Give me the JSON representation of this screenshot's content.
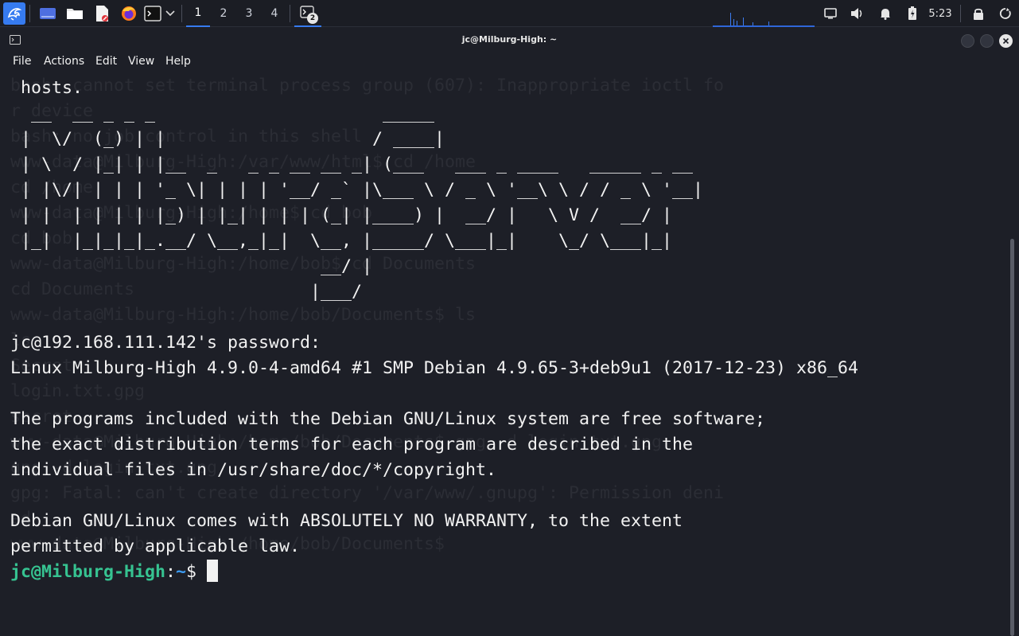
{
  "panel": {
    "workspaces": [
      "1",
      "2",
      "3",
      "4"
    ],
    "active_workspace": 1,
    "task_badge": "2",
    "clock": "5:23"
  },
  "window": {
    "title": "jc@Milburg-High: ~"
  },
  "menu": {
    "items": [
      "File",
      "Actions",
      "Edit",
      "View",
      "Help"
    ]
  },
  "terminal": {
    "ghost_lines": [
      "bash: cannot set terminal process group (607): Inappropriate ioctl fo",
      "r device",
      "bash: no job control in this shell",
      "www-data@Milburg-High:/var/www/html$ cd /home",
      "cd /home",
      "www-data@Milburg-High:/home$ cd bob",
      "cd bob",
      "www-data@Milburg-High:/home/bob$ cd Documents",
      "cd Documents",
      "www-data@Milburg-High:/home/bob/Documents$ ls",
      "ls",
      "Secret",
      "login.txt.gpg",
      "secret",
      "www-data@Milburg-High:/home/bob/Documents$ gpg -d login.txt.gpg",
      "gpg -d login.txt.gpg",
      "gpg: Fatal: can't create directory '/var/www/.gnupg': Permission deni",
      "ed",
      "www-data@Milburg-High:/home/bob/Documents$ "
    ],
    "hosts_line": " hosts.",
    "ascii_art": [
      "  __  __ _ _ _                      _____",
      " |  \\/  (_) | |                    / ____|",
      " | \\  / |_| | |__  _   _ _ __ __ _| (___   ___ _ ____   _____ _ __",
      " | |\\/| | | | '_ \\| | | | '__/ _` |\\___ \\ / _ \\ '__\\ \\ / / _ \\ '__|",
      " | |  | | | | |_) | |_| | | | (_| |____) |  __/ |   \\ V /  __/ |",
      " |_|  |_|_|_|_.__/ \\__,_|_|  \\__, |_____/ \\___|_|    \\_/ \\___|_|",
      "                              __/ |",
      "                             |___/"
    ],
    "output_lines": [
      "",
      "jc@192.168.111.142's password:",
      "Linux Milburg-High 4.9.0-4-amd64 #1 SMP Debian 4.9.65-3+deb9u1 (2017-12-23) x86_64",
      "",
      "The programs included with the Debian GNU/Linux system are free software;",
      "the exact distribution terms for each program are described in the",
      "individual files in /usr/share/doc/*/copyright.",
      "",
      "Debian GNU/Linux comes with ABSOLUTELY NO WARRANTY, to the extent",
      "permitted by applicable law."
    ],
    "prompt_user": "jc@Milburg-High",
    "prompt_colon": ":",
    "prompt_path": "~",
    "prompt_symbol": "$ "
  },
  "colors": {
    "background": "#1d1f27",
    "prompt_user": "#36c391",
    "prompt_path": "#3c9bf2",
    "accent": "#367bf0"
  },
  "icons": [
    "kali-dragon-icon",
    "show-desktop-icon",
    "file-manager-icon",
    "text-editor-icon",
    "firefox-icon",
    "terminal-icon",
    "chevron-down-icon",
    "display-icon",
    "volume-icon",
    "notification-bell-icon",
    "battery-icon",
    "lock-icon",
    "power-icon"
  ]
}
